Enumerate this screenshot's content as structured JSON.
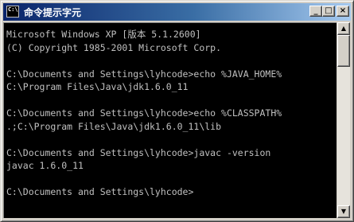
{
  "window": {
    "title": "命令提示字元",
    "icon_name": "console-icon",
    "icon_text": "C:\\"
  },
  "title_buttons": {
    "minimize": "_",
    "maximize": "□",
    "close": "×"
  },
  "console": {
    "lines": [
      "Microsoft Windows XP [版本 5.1.2600]",
      "(C) Copyright 1985-2001 Microsoft Corp.",
      "",
      "C:\\Documents and Settings\\lyhcode>echo %JAVA_HOME%",
      "C:\\Program Files\\Java\\jdk1.6.0_11",
      "",
      "C:\\Documents and Settings\\lyhcode>echo %CLASSPATH%",
      ".;C:\\Program Files\\Java\\jdk1.6.0_11\\lib",
      "",
      "C:\\Documents and Settings\\lyhcode>javac -version",
      "javac 1.6.0_11",
      "",
      "C:\\Documents and Settings\\lyhcode>"
    ],
    "text_color": "#c0c0c0",
    "background_color": "#000000"
  },
  "scrollbar": {
    "up_arrow": "▲",
    "down_arrow": "▼"
  },
  "colors": {
    "titlebar_start": "#0a246a",
    "titlebar_end": "#a6caf0",
    "chrome": "#d4d0c8"
  }
}
